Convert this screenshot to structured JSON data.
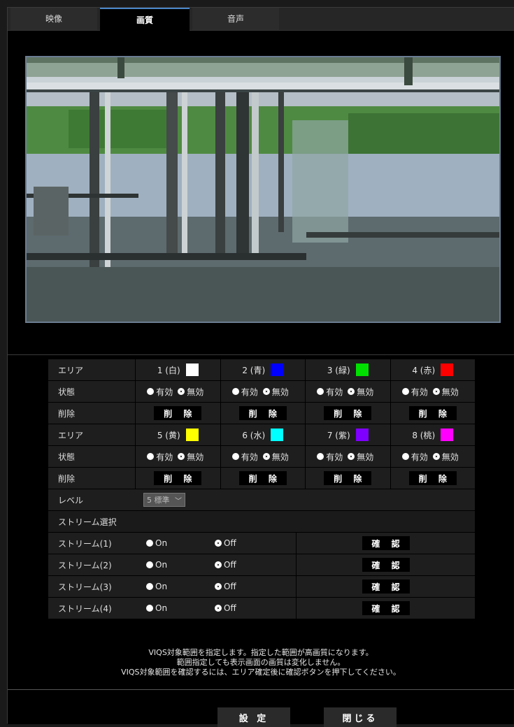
{
  "tabs": [
    "映像",
    "画質",
    "音声"
  ],
  "areas_top": {
    "row_label": "エリア",
    "items": [
      {
        "name": "1 (白)",
        "color": "#ffffff"
      },
      {
        "name": "2 (青)",
        "color": "#0000ff"
      },
      {
        "name": "3 (緑)",
        "color": "#00e000"
      },
      {
        "name": "4 (赤)",
        "color": "#ff0000"
      }
    ]
  },
  "areas_bottom": {
    "row_label": "エリア",
    "items": [
      {
        "name": "5 (黄)",
        "color": "#ffff00"
      },
      {
        "name": "6 (水)",
        "color": "#00ffff"
      },
      {
        "name": "7 (紫)",
        "color": "#8000ff"
      },
      {
        "name": "8 (桃)",
        "color": "#ff00ff"
      }
    ]
  },
  "state_label": "状態",
  "delete_label": "削除",
  "enable_label": "有効",
  "disable_label": "無効",
  "delete_button": "削 除",
  "level": {
    "label": "レベル",
    "value": "5 標準"
  },
  "stream_select_heading": "ストリーム選択",
  "streams": [
    {
      "label": "ストリーム(1)",
      "on": "On",
      "off": "Off",
      "confirm": "確 認"
    },
    {
      "label": "ストリーム(2)",
      "on": "On",
      "off": "Off",
      "confirm": "確 認"
    },
    {
      "label": "ストリーム(3)",
      "on": "On",
      "off": "Off",
      "confirm": "確 認"
    },
    {
      "label": "ストリーム(4)",
      "on": "On",
      "off": "Off",
      "confirm": "確 認"
    }
  ],
  "notes": [
    "VIQS対象範囲を指定します。指定した範囲が高画質になります。",
    "範囲指定しても表示画面の画質は変化しません。",
    "VIQS対象範囲を確認するには、エリア確定後に確認ボタンを押下してください。"
  ],
  "footer": {
    "set_label": "設 定",
    "close_label": "閉じる"
  }
}
